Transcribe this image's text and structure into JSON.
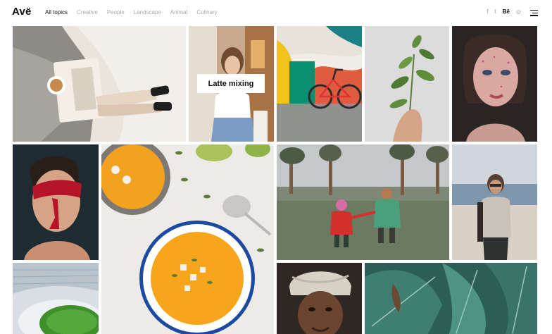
{
  "header": {
    "logo": "Avë",
    "nav": [
      {
        "label": "All topics",
        "active": true
      },
      {
        "label": "Creative",
        "active": false
      },
      {
        "label": "People",
        "active": false
      },
      {
        "label": "Landscape",
        "active": false
      },
      {
        "label": "Animal",
        "active": false
      },
      {
        "label": "Culinary",
        "active": false
      }
    ],
    "social": [
      {
        "icon": "facebook-icon",
        "glyph": "f"
      },
      {
        "icon": "twitter-icon",
        "glyph": "t"
      },
      {
        "icon": "behance-icon",
        "glyph": "Bē"
      },
      {
        "icon": "dribbble-icon",
        "glyph": "◎"
      }
    ],
    "menu_icon": "hamburger-menu-icon"
  },
  "gallery": {
    "items": [
      {
        "subject": "knit sweater coffee bed",
        "caption": ""
      },
      {
        "subject": "woman drinking coffee",
        "caption": "Latte mixing"
      },
      {
        "subject": "bicycle graffiti wall",
        "caption": ""
      },
      {
        "subject": "hand holding plant sprig",
        "caption": ""
      },
      {
        "subject": "portrait with glitter",
        "caption": ""
      },
      {
        "subject": "man red face paint",
        "caption": ""
      },
      {
        "subject": "pumpkin soup bowls",
        "caption": ""
      },
      {
        "subject": "couple walking field",
        "caption": ""
      },
      {
        "subject": "woman on beach",
        "caption": ""
      },
      {
        "subject": "architecture greenery",
        "caption": ""
      },
      {
        "subject": "man with turban",
        "caption": ""
      },
      {
        "subject": "tropical leaves",
        "caption": ""
      }
    ]
  },
  "colors": {
    "accent": "#111111",
    "nav_inactive": "#a9a9a9",
    "soup": "#f3a21f"
  }
}
